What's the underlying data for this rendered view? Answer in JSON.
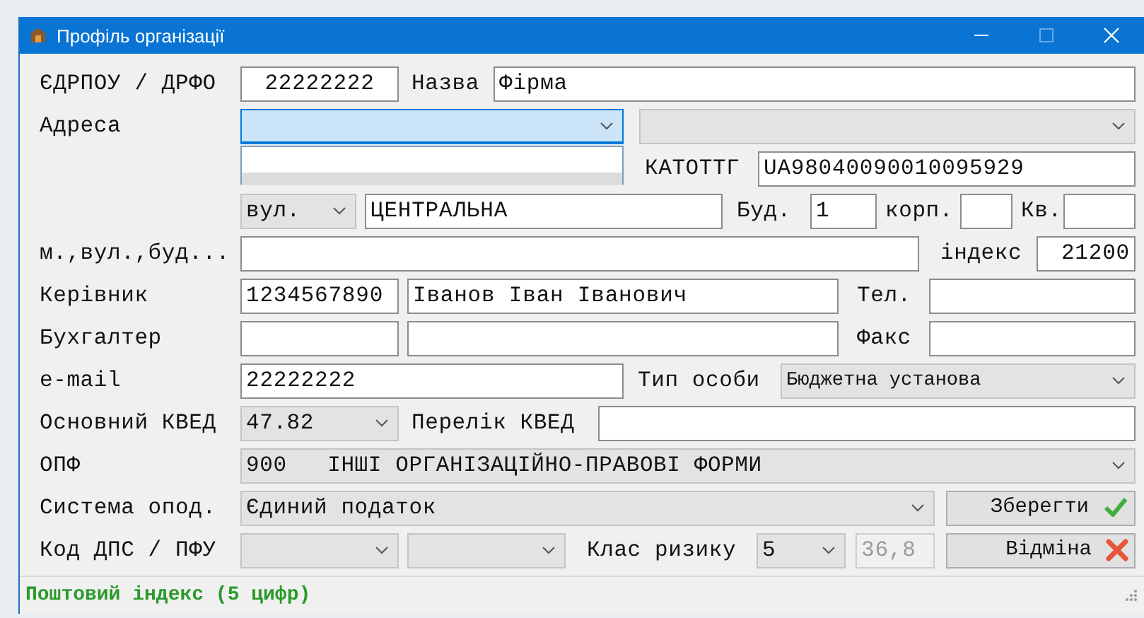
{
  "window": {
    "title": "Профіль організації"
  },
  "rows": [
    [
      {
        "kind": "label",
        "text": "ЄДРПОУ / ДРФО"
      },
      {
        "kind": "input",
        "value": "22222222"
      },
      {
        "kind": "label",
        "text": "Назва"
      },
      {
        "kind": "input",
        "value": "Фірма"
      }
    ],
    [
      {
        "kind": "label",
        "text": "Адреса"
      },
      {
        "kind": "select",
        "focused": true,
        "open": true
      },
      {
        "kind": "select",
        "focused": false,
        "open": false
      }
    ],
    [
      {
        "kind": "label",
        "text": "КАТОТТГ"
      },
      {
        "kind": "input",
        "value": "UA98040090010095929"
      }
    ],
    [
      {
        "kind": "select",
        "value": "вул.",
        "focused": false,
        "open": false
      },
      {
        "kind": "input",
        "value": "ЦЕНТРАЛЬНА"
      },
      {
        "kind": "label",
        "text": "Буд."
      },
      {
        "kind": "input",
        "value": "1"
      },
      {
        "kind": "label",
        "text": "корп."
      },
      {
        "kind": "input"
      },
      {
        "kind": "label",
        "text": "Кв."
      },
      {
        "kind": "input"
      }
    ],
    [
      {
        "kind": "label",
        "text": "м.,вул.,буд..."
      },
      {
        "kind": "input"
      },
      {
        "kind": "label",
        "text": "індекс"
      },
      {
        "kind": "input",
        "value": "21200"
      }
    ],
    [
      {
        "kind": "label",
        "text": "Керівник"
      },
      {
        "kind": "input",
        "value": "1234567890"
      },
      {
        "kind": "input",
        "value": "Іванов Іван Іванович"
      },
      {
        "kind": "label",
        "text": "Тел."
      },
      {
        "kind": "input"
      }
    ],
    [
      {
        "kind": "label",
        "text": "Бухгалтер"
      },
      {
        "kind": "input"
      },
      {
        "kind": "input"
      },
      {
        "kind": "label",
        "text": "Факс"
      },
      {
        "kind": "input"
      }
    ],
    [
      {
        "kind": "label",
        "text": "e-mail"
      },
      {
        "kind": "input",
        "value": "22222222"
      },
      {
        "kind": "label",
        "text": "Тип особи"
      },
      {
        "kind": "select",
        "value": "Бюджетна установа",
        "focused": false,
        "open": false
      }
    ],
    [
      {
        "kind": "label",
        "text": "Основний КВЕД"
      },
      {
        "kind": "select",
        "value": "47.82",
        "focused": false,
        "open": false
      },
      {
        "kind": "label",
        "text": "Перелік КВЕД"
      },
      {
        "kind": "input"
      }
    ],
    [
      {
        "kind": "label",
        "text": "ОПФ"
      },
      {
        "kind": "select",
        "value": "900   ІНШІ ОРГАНІЗАЦІЙНО-ПРАВОВІ ФОРМИ",
        "focused": false,
        "open": false
      }
    ],
    [
      {
        "kind": "label",
        "text": "Система опод."
      },
      {
        "kind": "select",
        "value": "Єдиний податок",
        "focused": false,
        "open": false
      },
      {
        "kind": "button",
        "label": "Зберегти"
      }
    ],
    [
      {
        "kind": "label",
        "text": "Код ДПС / ПФУ"
      },
      {
        "kind": "select",
        "focused": false,
        "open": false
      },
      {
        "kind": "select",
        "focused": false,
        "open": false
      },
      {
        "kind": "label",
        "text": "Клас ризику"
      },
      {
        "kind": "select",
        "value": "5",
        "focused": false,
        "open": false
      },
      {
        "kind": "input",
        "value": "36,8",
        "disabled": true
      },
      {
        "kind": "button",
        "label": "Відміна"
      }
    ]
  ],
  "status_bar": {
    "text": "Поштовий індекс (5 цифр)"
  }
}
